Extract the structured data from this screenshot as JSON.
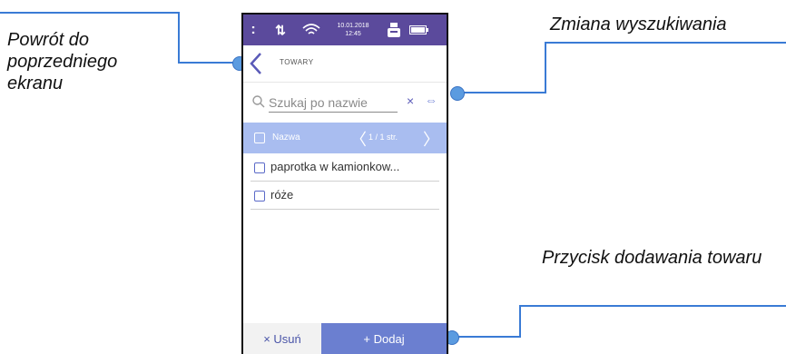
{
  "annotations": {
    "back": "Powrót do poprzedniego ekranu",
    "search_toggle": "Zmiana wyszukiwania",
    "add": "Przycisk dodawania towaru"
  },
  "statusbar": {
    "menu": ":",
    "network": "⇅",
    "date": "10.01.2018",
    "time": "12:45",
    "icons": [
      "menu-icon",
      "network-icon",
      "wifi-icon",
      "printer-icon",
      "battery-icon"
    ]
  },
  "header": {
    "title": "TOWARY"
  },
  "search": {
    "placeholder": "Szukaj po nazwie",
    "value": "",
    "clear": "×",
    "swap": "⇔"
  },
  "list_header": {
    "label": "Nazwa",
    "pagination": "1 / 1 str.",
    "prev": "〈",
    "next": "〉"
  },
  "items": [
    {
      "label": "paprotka w kamionkow..."
    },
    {
      "label": "róże"
    }
  ],
  "footer": {
    "delete_label": "× Usuń",
    "add_label": "+ Dodaj"
  },
  "colors": {
    "statusbar": "#5b4a9c",
    "list_header": "#a9bdf0",
    "add_button": "#6b7fd0",
    "callout": "#3a7bd5"
  }
}
